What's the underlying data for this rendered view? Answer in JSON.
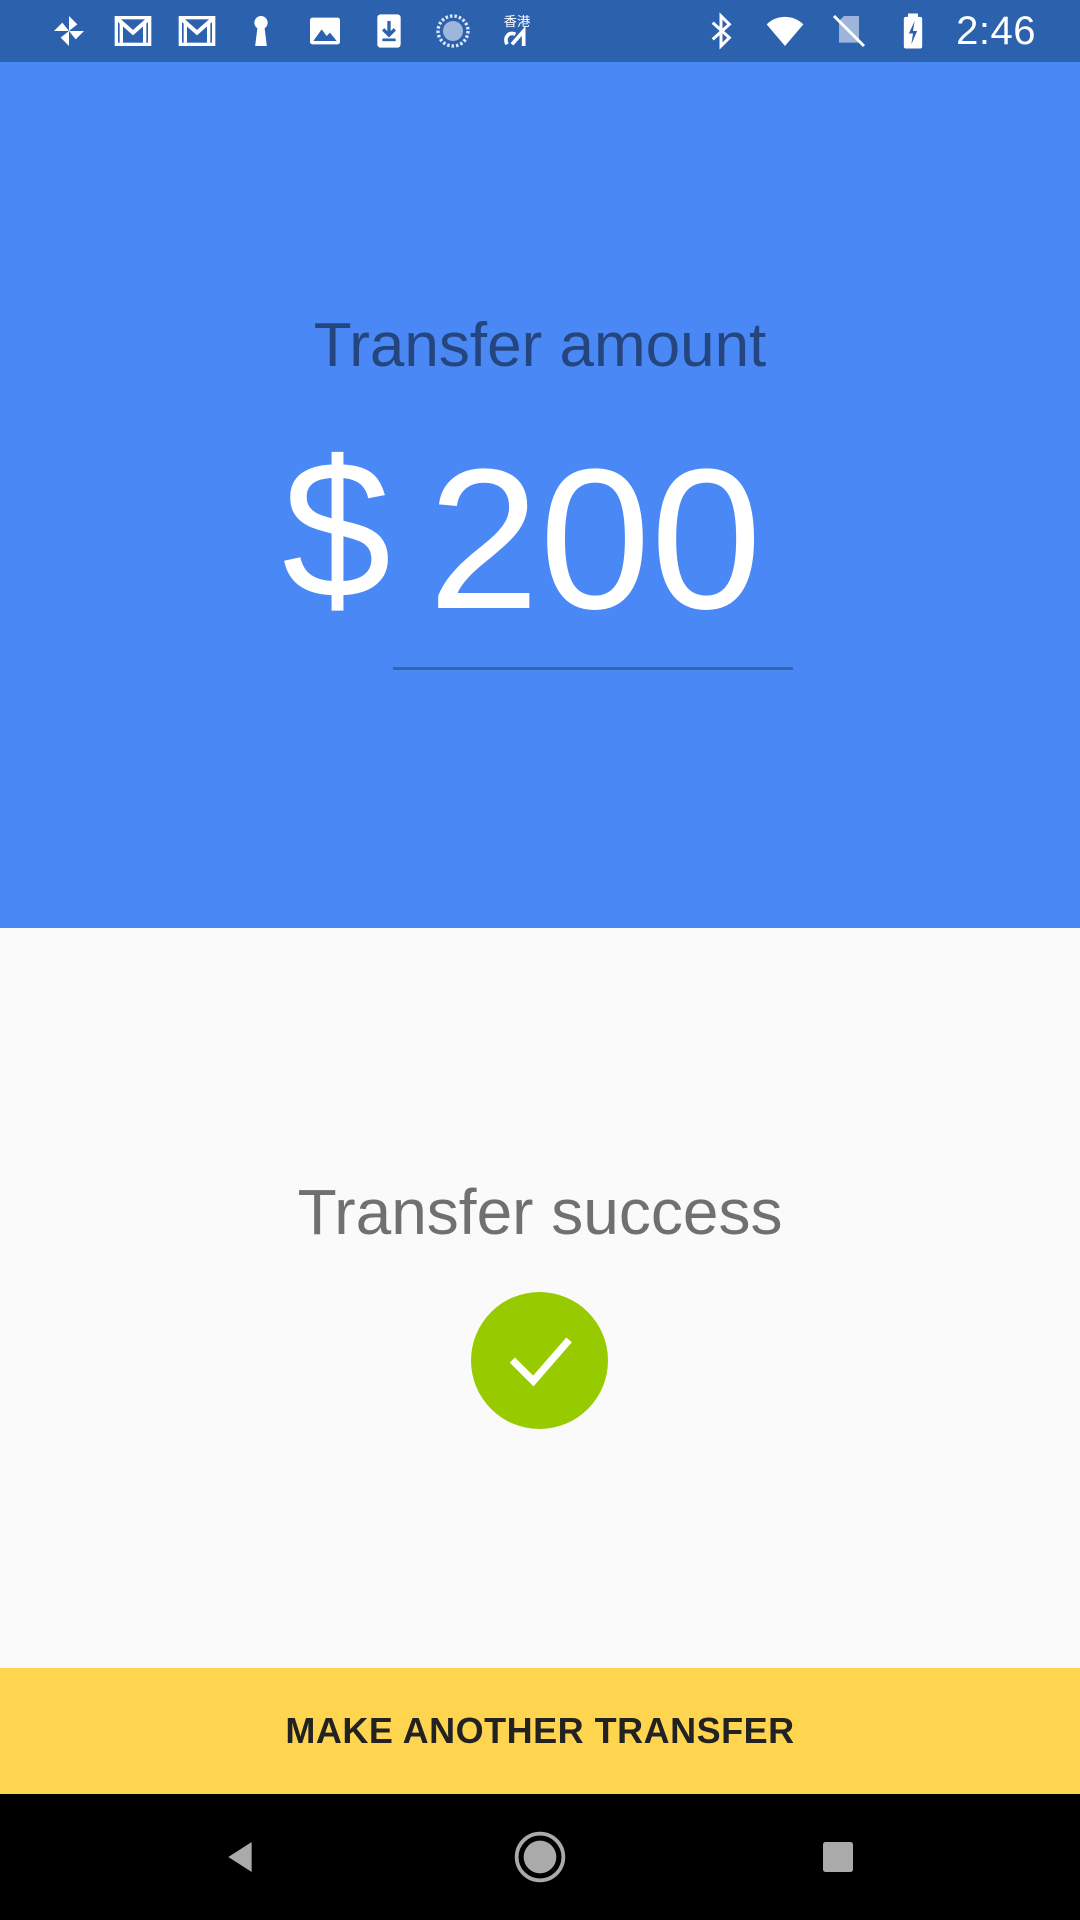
{
  "status_bar": {
    "time": "2:46",
    "left_icons": [
      "pinwheel-icon",
      "gmail-icon",
      "gmail-icon",
      "keyhole-icon",
      "image-icon",
      "download-icon",
      "loading-circle-icon",
      "hk-channel-icon"
    ],
    "right_icons": [
      "bluetooth-icon",
      "wifi-icon",
      "no-sim-icon",
      "battery-charging-icon"
    ],
    "background_color": "#2c62ad"
  },
  "amount_panel": {
    "label": "Transfer amount",
    "currency_symbol": "$",
    "amount": "200",
    "background_color": "#4a89f5"
  },
  "success": {
    "label": "Transfer success",
    "icon": "check-icon",
    "icon_color": "#97cb00"
  },
  "action_button": {
    "label": "MAKE ANOTHER TRANSFER",
    "color": "#ffd54f"
  },
  "nav_bar": {
    "buttons": [
      "back-icon",
      "home-icon",
      "recents-icon"
    ]
  }
}
